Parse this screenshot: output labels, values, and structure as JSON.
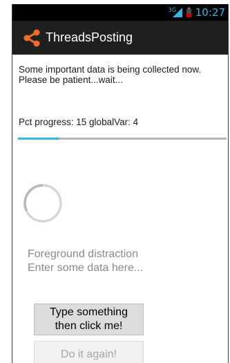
{
  "status_bar": {
    "network_type": "3G",
    "time": "10:27",
    "accent_color": "#33b5e5"
  },
  "action_bar": {
    "title": "ThreadsPosting",
    "icon": "share-icon",
    "icon_color": "#f26b2c"
  },
  "message": {
    "text": "Some important data is being collected now. Please be patient...wait..."
  },
  "progress": {
    "label": "Pct progress: 15  globalVar: 4",
    "fraction": 0.2
  },
  "distraction": {
    "line1": "Foreground distraction",
    "line2": "Enter some data here..."
  },
  "buttons": {
    "primary_line1": "Type something",
    "primary_line2": "then click me!",
    "secondary": "Do it again!"
  }
}
